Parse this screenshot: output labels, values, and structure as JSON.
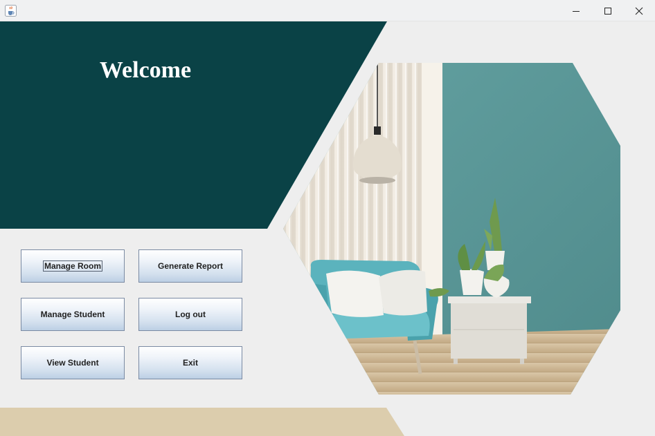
{
  "window": {
    "icon": "java-cup-icon",
    "controls": [
      "minimize-icon",
      "maximize-icon",
      "close-icon"
    ]
  },
  "welcome": {
    "title": "Welcome"
  },
  "buttons": {
    "manage_room": "Manage Room",
    "generate_report": "Generate Report",
    "manage_student": "Manage Student",
    "log_out": "Log out",
    "view_student": "View Student",
    "exit": "Exit"
  },
  "colors": {
    "banner": "#0a4246",
    "footer_band": "#dccdad",
    "background": "#eeeeee",
    "wall": "#5e9a9a",
    "chair": "#5bb3bd"
  },
  "photo": {
    "subject": "interior-room-photo"
  }
}
